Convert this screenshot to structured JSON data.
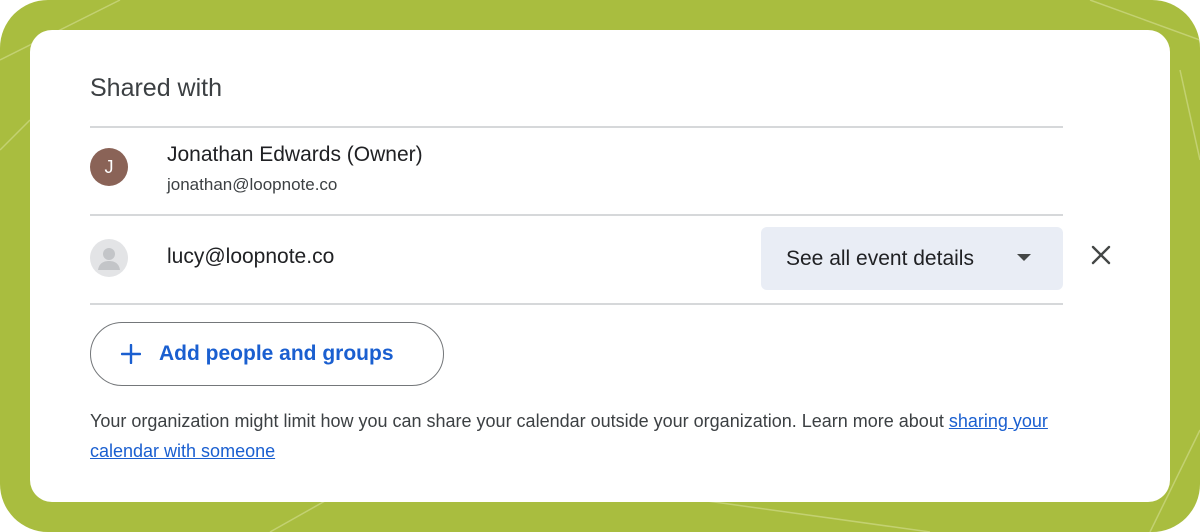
{
  "colors": {
    "backdrop": "#a9bd3f",
    "card": "#ffffff",
    "owner_avatar": "#8a6357",
    "select_bg": "#e9edf5",
    "link": "#1a5fd0"
  },
  "section": {
    "title": "Shared with"
  },
  "people": [
    {
      "initial": "J",
      "name": "Jonathan Edwards (Owner)",
      "email": "jonathan@loopnote.co",
      "avatar_icon": "initial-avatar"
    },
    {
      "email": "lucy@loopnote.co",
      "avatar_icon": "person-icon",
      "permission": "See all event details",
      "remove_icon": "close-icon"
    }
  ],
  "add_button": {
    "label": "Add people and groups",
    "icon": "plus-icon"
  },
  "note": {
    "text": "Your organization might limit how you can share your calendar outside your organization. Learn more about ",
    "link_text": "sharing your calendar with someone"
  }
}
